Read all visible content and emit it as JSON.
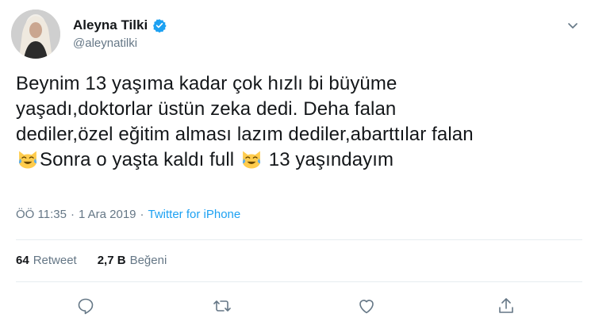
{
  "user": {
    "display_name": "Aleyna Tilki",
    "handle": "@aleynatilki",
    "verified": true,
    "accent": "#1da1f2"
  },
  "tweet": {
    "lines": [
      "Beynim 13 yaşıma kadar çok hızlı bi büyüme",
      "yaşadı,doktorlar üstün zeka dedi. Deha falan",
      "dediler,özel eğitim alması lazım dediler,abarttılar falan"
    ],
    "last_line": {
      "part1": "Sonra o yaşta kaldı full",
      "part2": "13 yaşındayım"
    },
    "emoji": "laughing-crying-cat-emoji"
  },
  "meta": {
    "time": "ÖÖ 11:35",
    "sep1": "·",
    "date": "1 Ara 2019",
    "sep2": "·",
    "source": "Twitter for iPhone"
  },
  "stats": {
    "retweet_count": "64",
    "retweet_label": "Retweet",
    "like_count": "2,7 B",
    "like_label": "Beğeni"
  },
  "actions": [
    "reply-icon",
    "retweet-icon",
    "like-icon",
    "share-icon"
  ],
  "colors": {
    "text": "#14171a",
    "muted": "#657786",
    "link": "#1da1f2",
    "divider": "#e6ecf0"
  }
}
